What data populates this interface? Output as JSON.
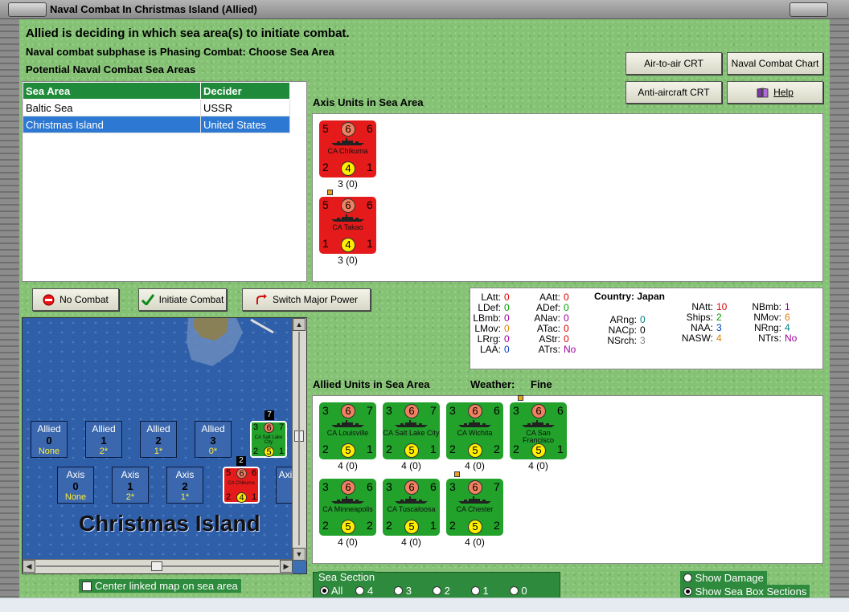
{
  "window": {
    "title": "Naval Combat In Christmas Island (Allied)"
  },
  "headers": {
    "line1": "Allied is deciding in which sea area(s) to initiate combat.",
    "line2": "Naval combat subphase is Phasing Combat: Choose Sea Area",
    "line3": "Potential Naval Combat Sea Areas"
  },
  "buttons": {
    "air_to_air": "Air-to-air CRT",
    "naval_chart": "Naval Combat Chart",
    "anti_aircraft": "Anti-aircraft CRT",
    "help": "Help",
    "no_combat": "No Combat",
    "initiate": "Initiate Combat",
    "switch": "Switch Major Power"
  },
  "sea_table": {
    "headers": [
      "Sea Area",
      "Decider"
    ],
    "rows": [
      [
        "Baltic Sea",
        "USSR"
      ],
      [
        "Christmas Island",
        "United States"
      ]
    ],
    "selected": 1
  },
  "axis_label": "Axis Units in Sea Area",
  "allied_label": "Allied Units in Sea Area",
  "weather": {
    "label": "Weather:",
    "value": "Fine"
  },
  "axis_units": [
    {
      "name": "CA Chikuma",
      "tl": "5",
      "tc": "6",
      "tr": "6",
      "bl": "2",
      "bc": "4",
      "br": "1",
      "caption": "3 (0)"
    },
    {
      "name": "CA Takao",
      "tl": "5",
      "tc": "6",
      "tr": "6",
      "bl": "1",
      "bc": "4",
      "br": "1",
      "caption": "3 (0)"
    }
  ],
  "allied_units": [
    {
      "name": "CA Louisville",
      "tl": "3",
      "tc": "6",
      "tr": "7",
      "bl": "2",
      "bc": "5",
      "br": "1",
      "caption": "4 (0)"
    },
    {
      "name": "CA Salt Lake City",
      "tl": "3",
      "tc": "6",
      "tr": "7",
      "bl": "2",
      "bc": "5",
      "br": "1",
      "caption": "4 (0)"
    },
    {
      "name": "CA Wichita",
      "tl": "3",
      "tc": "6",
      "tr": "6",
      "bl": "2",
      "bc": "5",
      "br": "2",
      "caption": "4 (0)"
    },
    {
      "name": "CA San Francisco",
      "tl": "3",
      "tc": "6",
      "tr": "6",
      "bl": "2",
      "bc": "5",
      "br": "1",
      "caption": "4 (0)"
    },
    {
      "name": "CA Minneapolis",
      "tl": "3",
      "tc": "6",
      "tr": "6",
      "bl": "2",
      "bc": "5",
      "br": "2",
      "caption": "4 (0)"
    },
    {
      "name": "CA Tuscaloosa",
      "tl": "3",
      "tc": "6",
      "tr": "6",
      "bl": "2",
      "bc": "5",
      "br": "1",
      "caption": "4 (0)"
    },
    {
      "name": "CA Chester",
      "tl": "3",
      "tc": "6",
      "tr": "7",
      "bl": "2",
      "bc": "5",
      "br": "2",
      "caption": "4 (0)"
    }
  ],
  "stats": {
    "country_label": "Country:",
    "country": "Japan",
    "col1": [
      [
        "LAtt:",
        "0",
        "#e00000"
      ],
      [
        "LDef:",
        "0",
        "#00a000"
      ],
      [
        "LBmb:",
        "0",
        "#a000a0"
      ],
      [
        "LMov:",
        "0",
        "#e08000"
      ],
      [
        "LRrg:",
        "0",
        "#a000a0"
      ],
      [
        "LAA:",
        "0",
        "#0040c0"
      ]
    ],
    "col2": [
      [
        "AAtt:",
        "0",
        "#e00000"
      ],
      [
        "ADef:",
        "0",
        "#00a000"
      ],
      [
        "ANav:",
        "0",
        "#a000a0"
      ],
      [
        "ATac:",
        "0",
        "#e00000"
      ],
      [
        "AStr:",
        "0",
        "#e00000"
      ],
      [
        "ATrs:",
        "No",
        "#a000a0"
      ]
    ],
    "col3": [
      [
        "ARng:",
        "0",
        "#008080"
      ],
      [
        "NACp:",
        "0",
        "#000000"
      ],
      [
        "NSrch:",
        "3",
        "#808080"
      ]
    ],
    "col4": [
      [
        "NAtt:",
        "10",
        "#e00000"
      ],
      [
        "Ships:",
        "2",
        "#00a000"
      ],
      [
        "NAA:",
        "3",
        "#0040c0"
      ],
      [
        "NASW:",
        "4",
        "#e08000"
      ]
    ],
    "col5": [
      [
        "NBmb:",
        "1",
        "#a000a0"
      ],
      [
        "NMov:",
        "6",
        "#e08000"
      ],
      [
        "NRng:",
        "4",
        "#008080"
      ],
      [
        "NTrs:",
        "No",
        "#a000a0"
      ]
    ]
  },
  "map": {
    "title": "Christmas Island",
    "allied_boxes": [
      [
        "Allied",
        "0",
        "None"
      ],
      [
        "Allied",
        "1",
        "2*"
      ],
      [
        "Allied",
        "2",
        "1*"
      ],
      [
        "Allied",
        "3",
        "0*"
      ]
    ],
    "axis_boxes": [
      [
        "Axis",
        "0",
        "None"
      ],
      [
        "Axis",
        "1",
        "2*"
      ],
      [
        "Axis",
        "2",
        "1*"
      ],
      [
        "Axis",
        ""
      ]
    ],
    "stack_allied": "7",
    "stack_axis": "2",
    "mini_allied": {
      "name": "CA Salt Lake City",
      "tl": "3",
      "tc": "6",
      "tr": "7",
      "bl": "2",
      "bc": "5",
      "br": "1"
    },
    "mini_axis": {
      "name": "CA Chikuma",
      "tl": "5",
      "tc": "6",
      "tr": "6",
      "bl": "2",
      "bc": "4",
      "br": "1"
    }
  },
  "center_checkbox": "Center linked map on sea area",
  "sea_section": {
    "label": "Sea Section",
    "options": [
      "All",
      "4",
      "3",
      "2",
      "1",
      "0"
    ],
    "selected": 0
  },
  "show_damage": "Show Damage",
  "show_sections": "Show Sea Box Sections",
  "colors": {
    "red_unit": "#e51b1b",
    "green_unit": "#22a12b",
    "table_header": "#1f8a3a",
    "selected_row": "#2c78d2"
  }
}
